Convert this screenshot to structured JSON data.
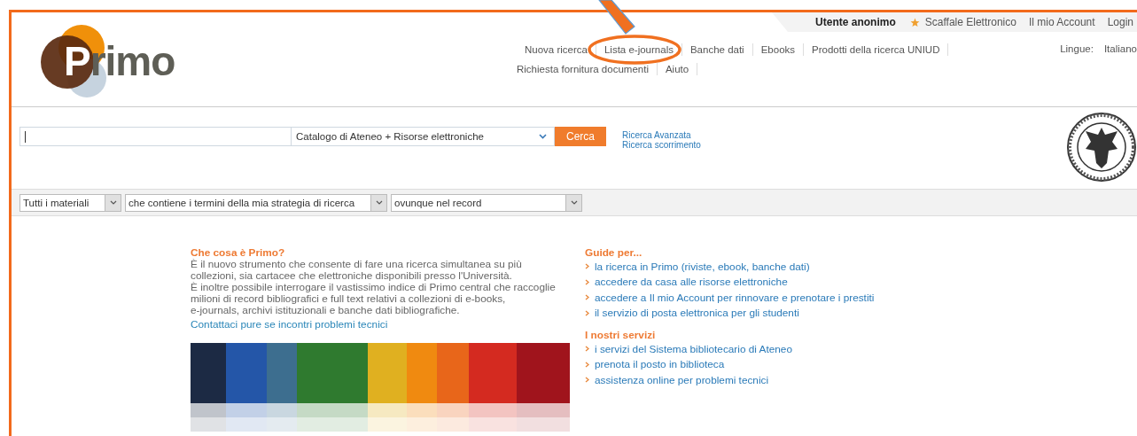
{
  "logo": "Primo",
  "user_bar": {
    "user": "Utente anonimo",
    "shelf": "Scaffale Elettronico",
    "account": "Il mio Account",
    "login": "Login"
  },
  "nav": {
    "items": [
      "Nuova ricerca",
      "Lista e-journals",
      "Banche dati",
      "Ebooks",
      "Prodotti della ricerca UNIUD",
      "Richiesta fornitura documenti",
      "Aiuto"
    ],
    "language_label": "Lingue:",
    "language": "Italiano"
  },
  "search": {
    "scope": "Catalogo di Ateneo + Risorse elettroniche",
    "button": "Cerca",
    "links": [
      "Ricerca Avanzata",
      "Ricerca scorrimento"
    ]
  },
  "filters": [
    "Tutti i materiali",
    "che contiene i termini della mia strategia di ricerca",
    "ovunque nel record"
  ],
  "about": {
    "title": "Che cosa è Primo?",
    "paragraphs": [
      "È il nuovo strumento che consente di fare una ricerca simultanea su più\ncollezioni, sia cartacee che elettroniche disponibili presso l'Università.",
      "È inoltre possibile interrogare il vastissimo indice di Primo central che raccoglie\nmilioni di record bibliografici e full text relativi a collezioni di e-books,\ne-journals, archivi istituzionali e banche dati bibliografiche."
    ],
    "link": "Contattaci pure se incontri problemi tecnici"
  },
  "guides": [
    {
      "title": "Guide per...",
      "links": [
        "la ricerca in Primo (riviste, ebook, banche dati)",
        "accedere da casa alle risorse elettroniche",
        "accedere a Il mio Account per rinnovare e prenotare i prestiti",
        "il servizio di posta elettronica per gli studenti"
      ]
    },
    {
      "title": "I nostri servizi",
      "links": [
        "i servizi del Sistema bibliotecario di Ateneo",
        "prenota il posto in biblioteca",
        "assistenza online per problemi tecnici"
      ]
    }
  ]
}
